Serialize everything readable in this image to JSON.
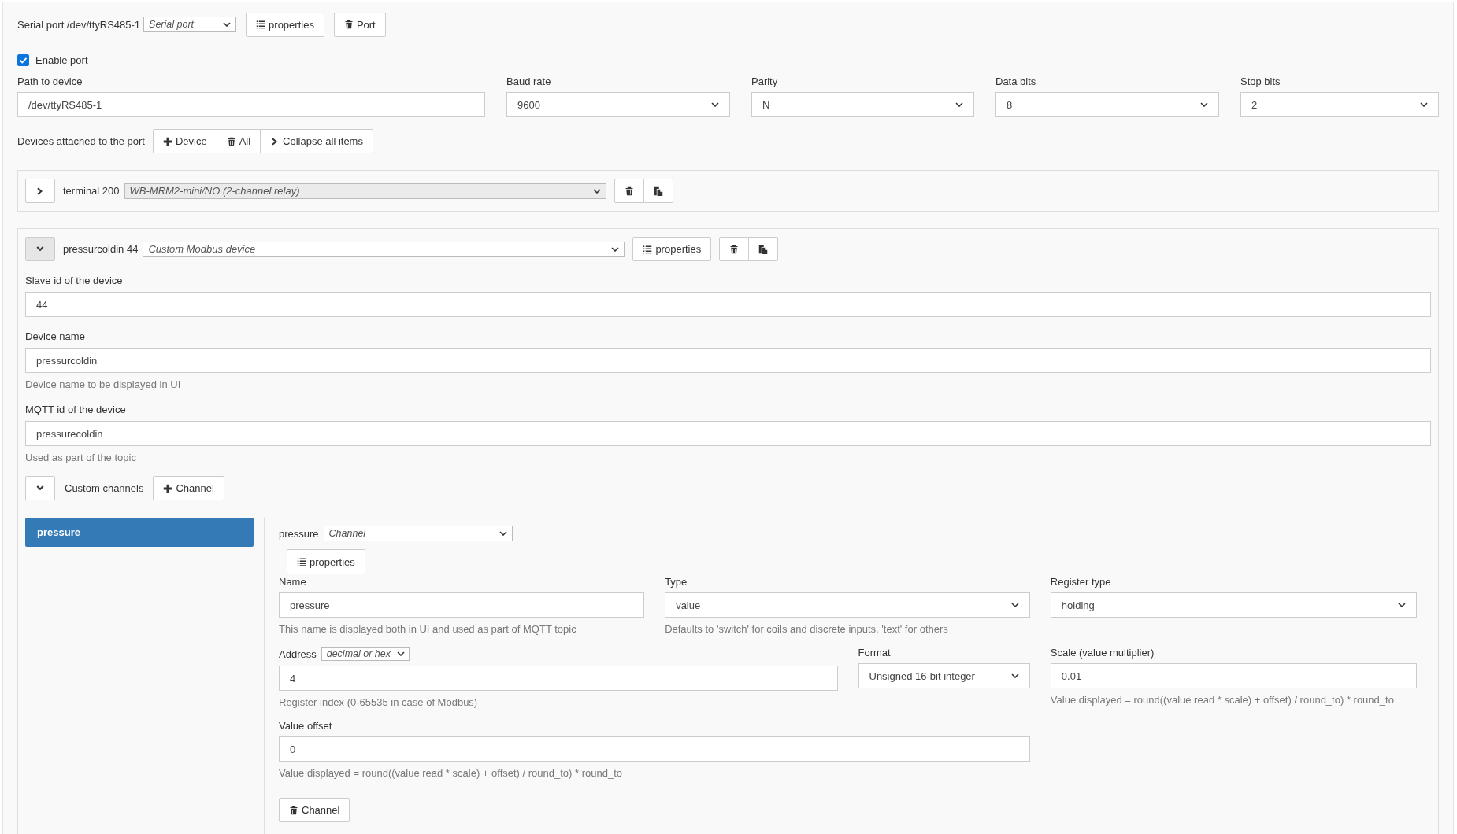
{
  "port": {
    "title": "Serial port /dev/ttyRS485-1",
    "type_select": "Serial port",
    "buttons": [
      {
        "kind": "properties",
        "label": "properties"
      },
      {
        "kind": "delete",
        "label": "Port"
      }
    ]
  },
  "enable_port": {
    "label": "Enable port",
    "checked": true
  },
  "port_fields": [
    {
      "label": "Path to device",
      "kind": "input",
      "value": "/dev/ttyRS485-1"
    },
    {
      "label": "Baud rate",
      "kind": "select",
      "value": "9600"
    },
    {
      "label": "Parity",
      "kind": "select",
      "value": "N"
    },
    {
      "label": "Data bits",
      "kind": "select",
      "value": "8"
    },
    {
      "label": "Stop bits",
      "kind": "select",
      "value": "2"
    }
  ],
  "devices": {
    "label": "Devices attached to the port",
    "buttons": [
      {
        "kind": "add",
        "label": "Device"
      },
      {
        "kind": "delete",
        "label": "All"
      },
      {
        "kind": "collapse",
        "label": "Collapse all items"
      }
    ],
    "items": [
      {
        "title": "terminal 200",
        "type": "WB-MRM2-mini/NO (2-channel relay)",
        "disabled": true,
        "expanded": false,
        "buttons": [
          {
            "kind": "delete"
          },
          {
            "kind": "copy"
          }
        ]
      },
      {
        "title": "pressurcoldin 44",
        "type": "Custom Modbus device",
        "disabled": false,
        "expanded": true,
        "properties": "properties",
        "buttons": [
          {
            "kind": "delete"
          },
          {
            "kind": "copy"
          }
        ],
        "fields": [
          {
            "label": "Slave id of the device",
            "value": "44"
          },
          {
            "label": "Device name",
            "value": "pressurcoldin",
            "help": "Device name to be displayed in UI"
          },
          {
            "label": "MQTT id of the device",
            "value": "pressurecoldin",
            "help": "Used as part of the topic"
          }
        ],
        "custom_channels": {
          "label": "Custom channels",
          "expanded": true,
          "add_button": {
            "label": "Channel"
          },
          "channels": [
            {
              "name": "pressure",
              "selected": true
            }
          ],
          "editor": {
            "title": "pressure",
            "type_select": "Channel",
            "properties": "properties",
            "fields": [
              {
                "label": "Name",
                "kind": "input",
                "value": "pressure",
                "help": "This name is displayed both in UI and used as part of MQTT topic"
              },
              {
                "label": "Type",
                "kind": "select",
                "value": "value",
                "help": "Defaults to 'switch' for coils and discrete inputs, 'text' for others"
              },
              {
                "label": "Register type",
                "kind": "select",
                "value": "holding"
              },
              {
                "label": "Address",
                "kind": "input",
                "label_select": "decimal or hex",
                "value": "4",
                "help": "Register index (0-65535 in case of Modbus)"
              },
              {
                "label": "Format",
                "kind": "select",
                "value": "Unsigned 16-bit integer"
              },
              {
                "label": "Scale (value multiplier)",
                "kind": "input",
                "value": "0.01",
                "help": "Value displayed = round((value read * scale) + offset) / round_to) * round_to"
              },
              {
                "label": "Value offset",
                "kind": "input",
                "value": "0",
                "help": "Value displayed = round((value read * scale) + offset) / round_to) * round_to"
              }
            ],
            "delete_button": {
              "label": "Channel"
            }
          }
        }
      }
    ]
  }
}
